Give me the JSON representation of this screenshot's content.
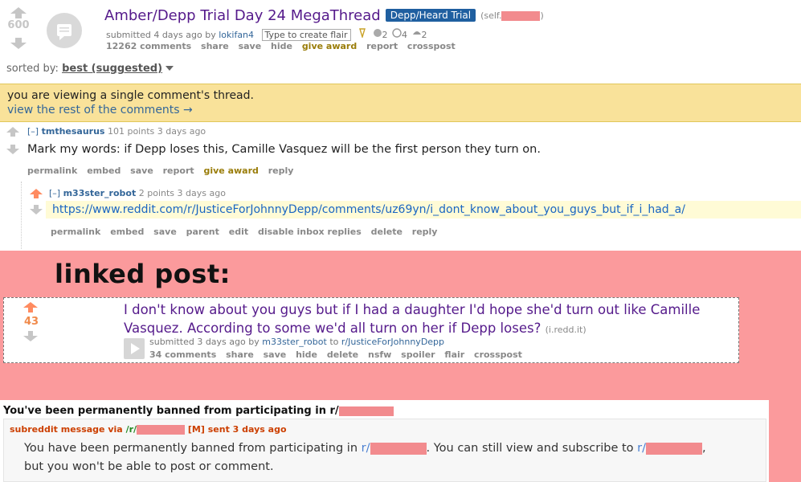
{
  "post": {
    "score": "600",
    "title": "Amber/Depp Trial Day 24 MegaThread",
    "flair": "Depp/Heard Trial",
    "domain_prefix": "(self.",
    "domain_suffix": ")",
    "tagline_prefix": "submitted 4 days ago by",
    "author": "lokifan4",
    "flair_prompt": "Type to create flair",
    "award_1": "2",
    "award_2": "4",
    "award_3": "2",
    "buttons": [
      "12262 comments",
      "share",
      "save",
      "hide",
      "give award",
      "report",
      "crosspost"
    ]
  },
  "sort": {
    "label": "sorted by:",
    "value": "best (suggested)"
  },
  "banner": {
    "line1": "you are viewing a single comment's thread.",
    "line2": "view the rest of the comments →"
  },
  "comment1": {
    "collapse": "[–]",
    "author": "tmthesaurus",
    "meta": "101 points 3 days ago",
    "body": "Mark my words: if Depp loses this, Camille Vasquez will be the first person they turn on.",
    "buttons": [
      "permalink",
      "embed",
      "save",
      "report",
      "give award",
      "reply"
    ]
  },
  "comment2": {
    "collapse": "[–]",
    "author": "m33ster_robot",
    "meta": "2 points 3 days ago",
    "link": "https://www.reddit.com/r/JusticeForJohnnyDepp/comments/uz69yn/i_dont_know_about_you_guys_but_if_i_had_a/",
    "buttons": [
      "permalink",
      "embed",
      "save",
      "parent",
      "edit",
      "disable inbox replies",
      "delete",
      "reply"
    ]
  },
  "linked": {
    "label": "linked post:",
    "score": "43",
    "title": "I don't know about you guys but if I had a daughter I'd hope she'd turn out like Camille Vasquez. According to some we'd all turn on her if Depp loses?",
    "domain": "(i.redd.it)",
    "tagline_prefix": "submitted 3 days ago by",
    "author": "m33ster_robot",
    "to": "to",
    "subreddit": "r/JusticeForJohnnyDepp",
    "buttons": [
      "34 comments",
      "share",
      "save",
      "hide",
      "delete",
      "nsfw",
      "spoiler",
      "flair",
      "crosspost"
    ]
  },
  "ban": {
    "header": "You've been permanently banned from participating in r/",
    "meta_prefix": "subreddit message via",
    "meta_sub": "/r/",
    "meta_mod": "[M]",
    "meta_sent": "sent 3 days ago",
    "line1_a": "You have been permanently banned from participating in",
    "line1_b": "r/",
    "line1_c": ". You can still view and subscribe to",
    "line1_d": "r/",
    "line1_e": ",",
    "line2": "but you won't be able to post or comment."
  },
  "colors": {
    "redaction": "#f28b8e",
    "pink_bg": "#fb9a9c",
    "banner_bg": "#f9e29a",
    "link": "#336699"
  }
}
